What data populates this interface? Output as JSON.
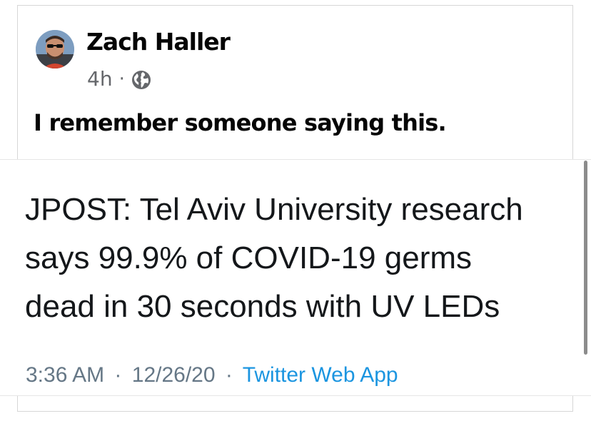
{
  "post": {
    "author_name": "Zach Haller",
    "time": "4h",
    "separator": "·",
    "privacy_icon": "globe-icon",
    "text": "I remember someone saying this."
  },
  "tweet": {
    "lines": [
      "JPOST: Tel Aviv University research",
      "says 99.9% of COVID-19 germs",
      "dead in 30 seconds with UV LEDs"
    ],
    "time": "3:36 AM",
    "date": "12/26/20",
    "separator": "·",
    "source": "Twitter Web App"
  },
  "colors": {
    "text_primary": "#050505",
    "text_secondary": "#65676b",
    "tweet_text": "#14171a",
    "tweet_meta": "#657786",
    "tweet_link": "#1b95e0"
  }
}
